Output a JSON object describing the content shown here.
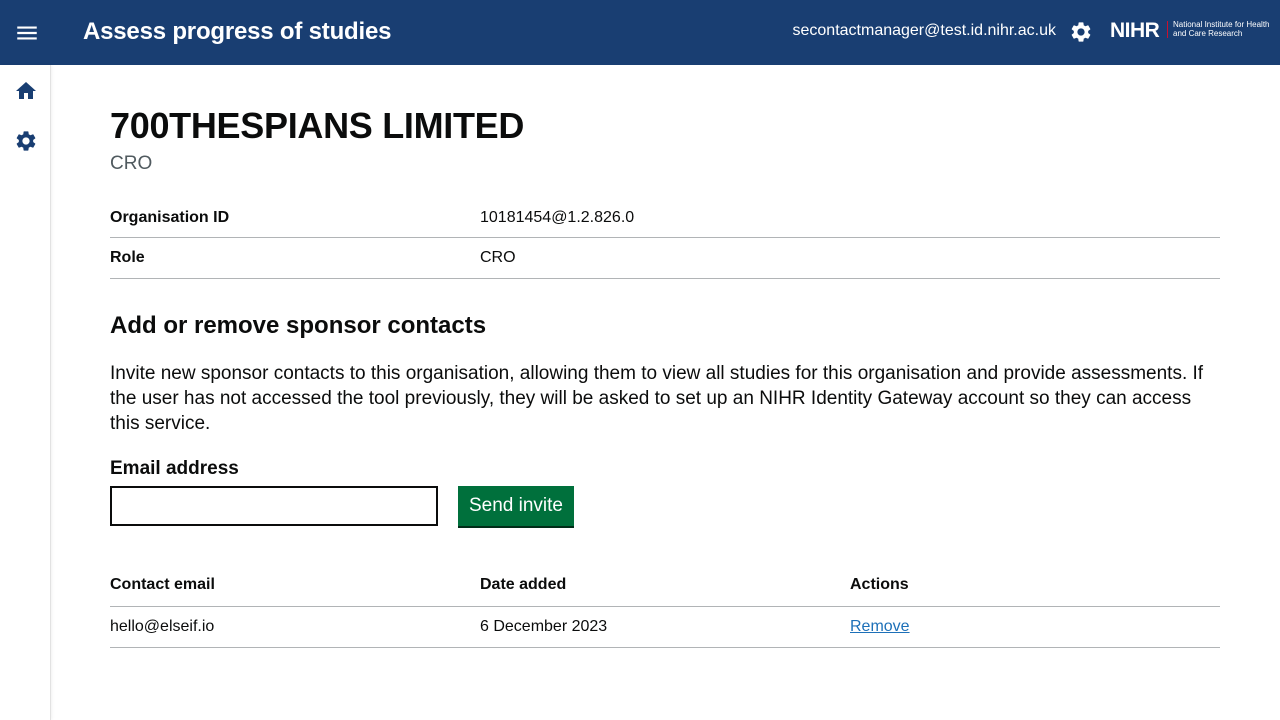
{
  "header": {
    "title": "Assess progress of studies",
    "user_email": "secontactmanager@test.id.nihr.ac.uk",
    "logo_mark": "NIHR",
    "logo_text": "National Institute for Health and Care Research"
  },
  "sidebar": {
    "items": [
      {
        "icon": "home-icon"
      },
      {
        "icon": "gear-icon"
      }
    ]
  },
  "organisation": {
    "name": "700THESPIANS LIMITED",
    "caption": "CRO",
    "summary": [
      {
        "key": "Organisation ID",
        "value": "10181454@1.2.826.0"
      },
      {
        "key": "Role",
        "value": "CRO"
      }
    ]
  },
  "contacts_section": {
    "heading": "Add or remove sponsor contacts",
    "description": "Invite new sponsor contacts to this organisation, allowing them to view all studies for this organisation and provide assessments. If the user has not accessed the tool previously, they will be asked to set up an NIHR Identity Gateway account so they can access this service.",
    "email_label": "Email address",
    "email_value": "",
    "send_button": "Send invite"
  },
  "contacts_table": {
    "headers": [
      "Contact email",
      "Date added",
      "Actions"
    ],
    "rows": [
      {
        "email": "hello@elseif.io",
        "date_added": "6 December 2023",
        "action": "Remove"
      }
    ]
  },
  "colors": {
    "header_bg": "#193e72",
    "primary_button": "#00703c",
    "link": "#1d70b8"
  }
}
